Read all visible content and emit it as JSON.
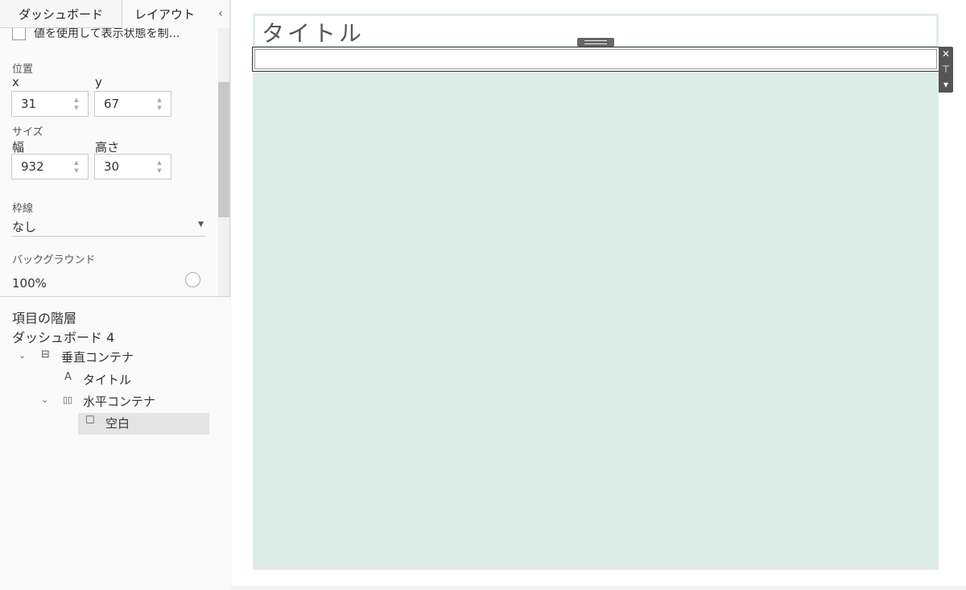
{
  "tabs": [
    {
      "label": "ダッシュボード"
    },
    {
      "label": "レイアウト"
    }
  ],
  "collapse_glyph": "‹",
  "visibility": {
    "label": "値を使用して表示状態を制…"
  },
  "position": {
    "section_label": "位置",
    "x_label": "x",
    "y_label": "y",
    "x_value": "31",
    "y_value": "67"
  },
  "size": {
    "section_label": "サイズ",
    "width_label": "幅",
    "height_label": "高さ",
    "width_value": "932",
    "height_value": "30"
  },
  "border": {
    "label": "枠線",
    "value": "なし"
  },
  "background": {
    "label": "バックグラウンド",
    "value": "100%"
  },
  "hierarchy": {
    "title": "項目の階層",
    "dashboard_name": "ダッシュボード 4",
    "items": [
      {
        "label": "垂直コンテナ",
        "icon": "vertical-container-icon",
        "glyph": "⊟"
      },
      {
        "label": "タイトル",
        "icon": "text-icon",
        "glyph": "A"
      },
      {
        "label": "水平コンテナ",
        "icon": "horizontal-container-icon",
        "glyph": "▯▯"
      },
      {
        "label": "空白",
        "icon": "blank-icon",
        "glyph": "☐"
      }
    ]
  },
  "canvas": {
    "title": "タイトル",
    "container_color": "#dfede9",
    "toolbar": {
      "close": "✕",
      "pin": "⊤",
      "menu": "▾"
    }
  }
}
